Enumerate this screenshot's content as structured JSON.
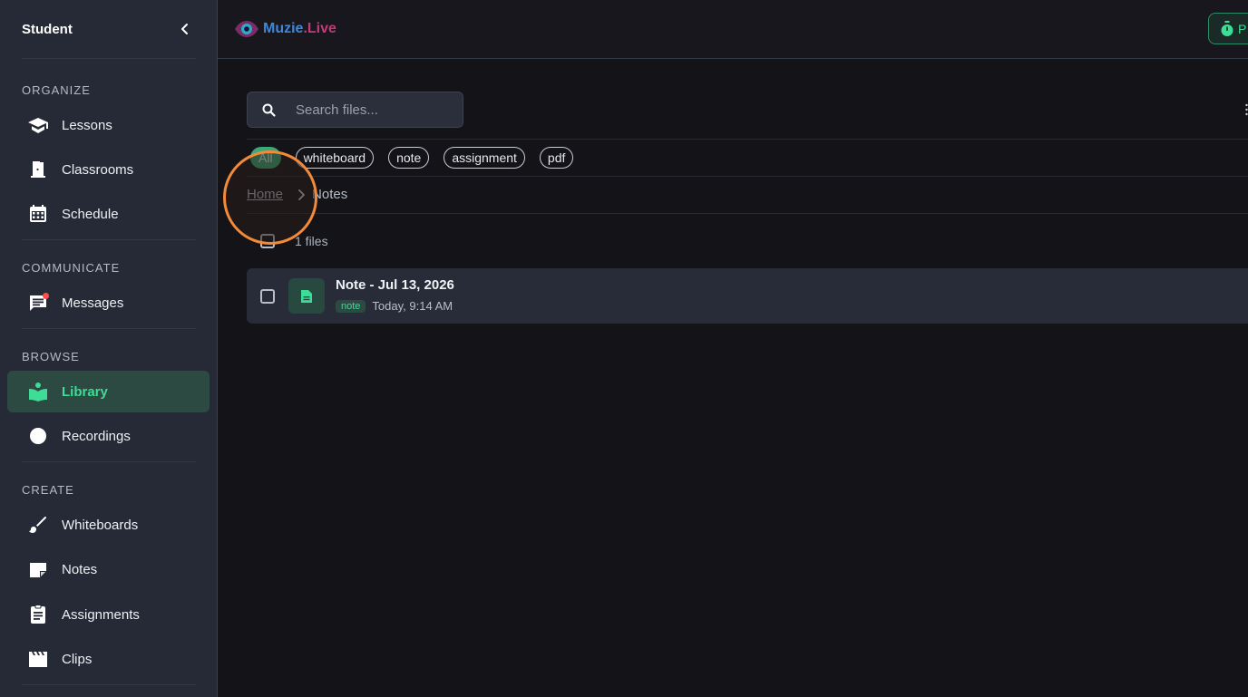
{
  "sidebar": {
    "title": "Student",
    "sections": {
      "organize": "ORGANIZE",
      "communicate": "COMMUNICATE",
      "browse": "BROWSE",
      "create": "CREATE"
    },
    "items": {
      "lessons": "Lessons",
      "classrooms": "Classrooms",
      "schedule": "Schedule",
      "messages": "Messages",
      "library": "Library",
      "recordings": "Recordings",
      "whiteboards": "Whiteboards",
      "notes": "Notes",
      "assignments": "Assignments",
      "clips": "Clips"
    },
    "active_item": "Library",
    "messages_has_notification": true
  },
  "header": {
    "logo_part1": "Muzie",
    "logo_part2": ".Live",
    "top_button_label": "P"
  },
  "search": {
    "placeholder": "Search files..."
  },
  "filters": [
    "All",
    "whiteboard",
    "note",
    "assignment",
    "pdf"
  ],
  "active_filter": "All",
  "breadcrumb": {
    "home": "Home",
    "current": "Notes"
  },
  "files": {
    "count_label": "1 files",
    "items": [
      {
        "name": "Note - Jul 13, 2026",
        "tag": "note",
        "date": "Today, 9:14 AM"
      }
    ]
  },
  "colors": {
    "accent": "#3ddc97",
    "highlight_ring": "#f28a3a",
    "notification": "#ff4d4d"
  }
}
